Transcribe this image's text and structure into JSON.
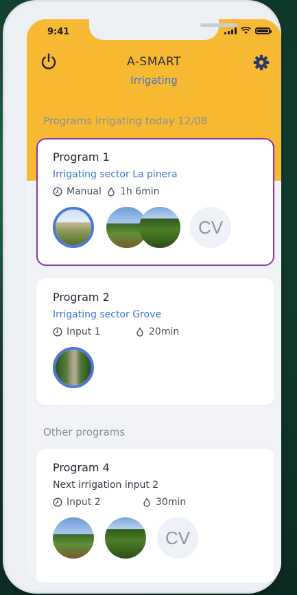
{
  "status_bar": {
    "time": "9:41"
  },
  "header": {
    "title": "A-SMART",
    "subtitle": "Irrigating"
  },
  "sections": {
    "today_title": "Programs irrigating today 12/08",
    "other_title": "Other programs"
  },
  "programs": [
    {
      "name": "Program 1",
      "description": "Irrigating sector La pinera",
      "trigger": "Manual",
      "duration": "1h 6min",
      "photo_badge": "CV"
    },
    {
      "name": "Program 2",
      "description": "Irrigating sector Grove",
      "trigger": "Input 1",
      "duration": "20min"
    },
    {
      "name": "Program 4",
      "description": "Next irrigation input 2",
      "trigger": "Input 2",
      "duration": "30min",
      "photo_badge": "CV"
    }
  ],
  "colors": {
    "accent_yellow": "#f8b932",
    "link_blue": "#3f74cf",
    "active_border": "#8d3a9c",
    "selected_ring": "#4b78d8"
  },
  "icons": [
    "power-icon",
    "gear-icon",
    "clock-icon",
    "drop-icon",
    "signal-icon",
    "wifi-icon",
    "battery-icon"
  ]
}
